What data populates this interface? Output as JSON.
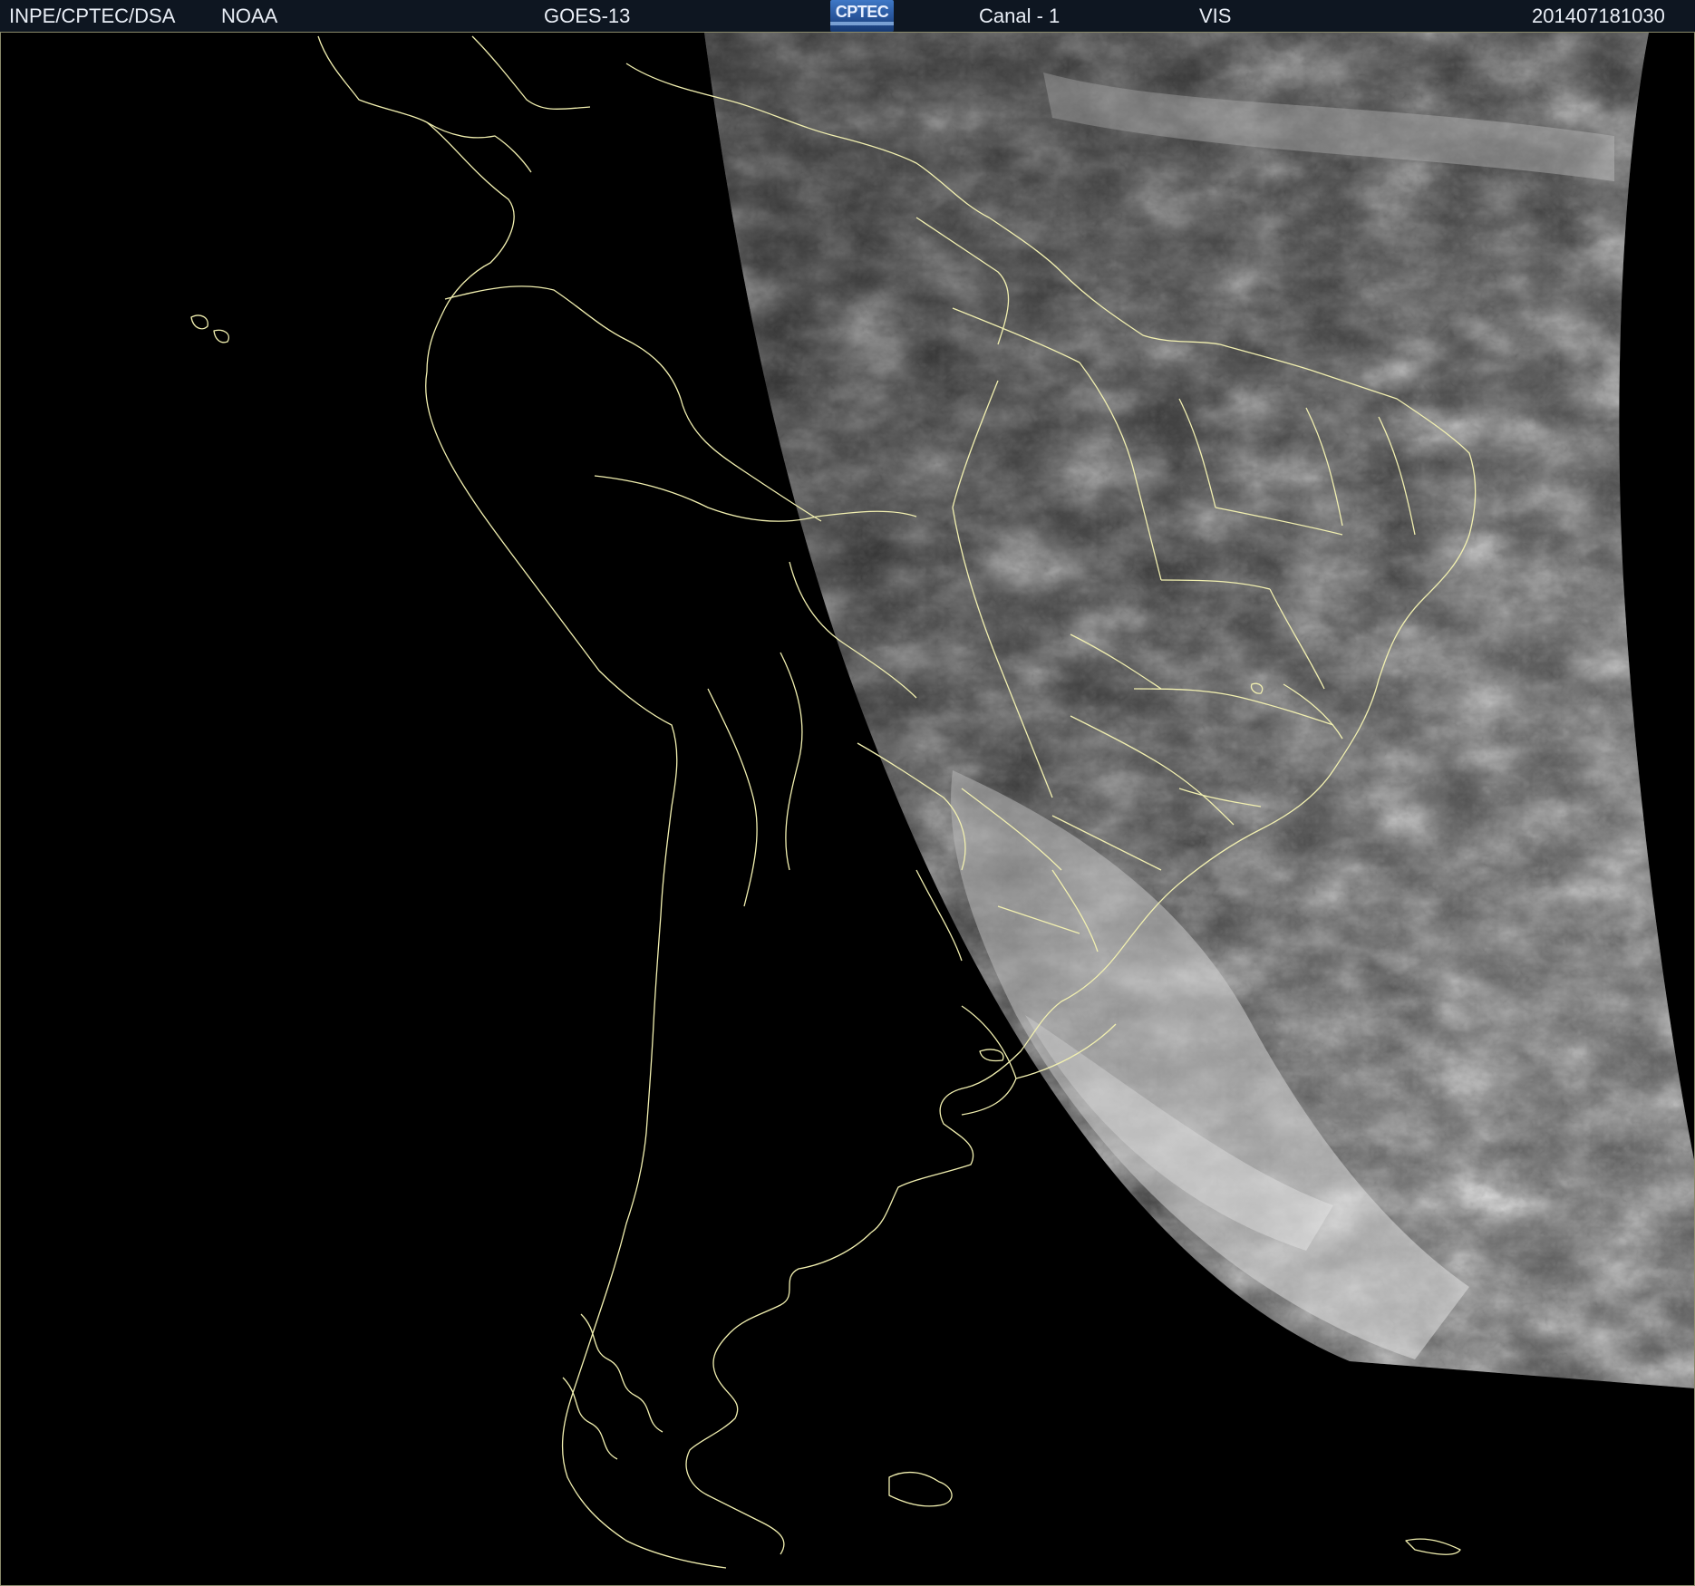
{
  "header": {
    "agency": "INPE/CPTEC/DSA",
    "operator": "NOAA",
    "satellite": "GOES-13",
    "logo_text": "CPTEC",
    "channel": "Canal - 1",
    "band": "VIS",
    "timestamp": "201407181030"
  },
  "colors": {
    "header_bg": "#0e1621",
    "border_lines": "#f2f0b0",
    "space": "#000000",
    "cloud_bright": "#e6e6e6",
    "ocean_dark": "#3a3a3a"
  },
  "map": {
    "type": "satellite-visible-image",
    "region": "South America",
    "boundaries": "national and state outlines"
  }
}
